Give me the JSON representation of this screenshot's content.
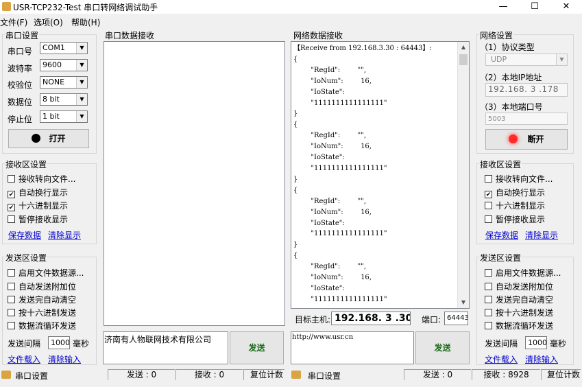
{
  "window": {
    "title": "USR-TCP232-Test 串口转网络调试助手",
    "minimize": "—",
    "maximize": "☐",
    "close": "✕"
  },
  "menu": {
    "file": "文件(F)",
    "options": "选项(O)",
    "help": "帮助(H)"
  },
  "serial_settings": {
    "title": "串口设置",
    "port_label": "串口号",
    "port_value": "COM1",
    "baud_label": "波特率",
    "baud_value": "9600",
    "parity_label": "校验位",
    "parity_value": "NONE",
    "data_label": "数据位",
    "data_value": "8 bit",
    "stop_label": "停止位",
    "stop_value": "1 bit",
    "open_button": "打开"
  },
  "serial_recv_settings": {
    "title": "接收区设置",
    "redirect": "接收转向文件...",
    "auto_newline": "自动换行显示",
    "hex_display": "十六进制显示",
    "pause": "暂停接收显示",
    "save": "保存数据",
    "clear": "清除显示",
    "checked": [
      false,
      true,
      true,
      false
    ]
  },
  "serial_send_settings": {
    "title": "发送区设置",
    "file_source": "启用文件数据源...",
    "auto_append": "自动发送附加位",
    "auto_clear": "发送完自动清空",
    "hex_send": "按十六进制发送",
    "loop_send": "数据流循环发送",
    "interval_label": "发送间隔",
    "interval_value": "1000",
    "interval_unit": "毫秒",
    "load_file": "文件载入",
    "clear_input": "清除输入"
  },
  "serial_recv": {
    "title": "串口数据接收"
  },
  "serial_send": {
    "text": "济南有人物联网技术有限公司",
    "send_button": "发送"
  },
  "net_recv": {
    "title": "网络数据接收",
    "content": "【Receive from 192.168.3.30 : 64443】:\n{\n        \"RegId\":        \"\",\n        \"IoNum\":        16,\n        \"IoState\":\n        \"1111111111111111\"\n}\n{\n        \"RegId\":        \"\",\n        \"IoNum\":        16,\n        \"IoState\":\n        \"1111111111111111\"\n}\n{\n        \"RegId\":        \"\",\n        \"IoNum\":        16,\n        \"IoState\":\n        \"1111111111111111\"\n}\n{\n        \"RegId\":        \"\",\n        \"IoNum\":        16,\n        \"IoState\":\n        \"1111111111111111\""
  },
  "net_target": {
    "host_label": "目标主机:",
    "host_value": "192.168. 3 .30",
    "port_label": "端口:",
    "port_value": "64443"
  },
  "net_send": {
    "text": "http://www.usr.cn",
    "send_button": "发送"
  },
  "net_settings": {
    "title": "网络设置",
    "protocol_label": "（1）协议类型",
    "protocol_value": "UDP",
    "ip_label": "（2）本地IP地址",
    "ip_value": "192.168. 3 .178",
    "port_label": "（3）本地端口号",
    "port_value": "5003",
    "disconnect_button": "断开"
  },
  "net_recv_settings": {
    "title": "接收区设置",
    "redirect": "接收转向文件...",
    "auto_newline": "自动换行显示",
    "hex_display": "十六进制显示",
    "pause": "暂停接收显示",
    "save": "保存数据",
    "clear": "清除显示",
    "checked": [
      false,
      true,
      false,
      false
    ]
  },
  "net_send_settings": {
    "title": "发送区设置",
    "file_source": "启用文件数据源...",
    "auto_append": "自动发送附加位",
    "auto_clear": "发送完自动清空",
    "hex_send": "按十六进制发送",
    "loop_send": "数据流循环发送",
    "interval_label": "发送间隔",
    "interval_value": "1000",
    "interval_unit": "毫秒",
    "load_file": "文件载入",
    "clear_input": "清除输入"
  },
  "status": {
    "left_label": "串口设置",
    "left_sent": "发送 : 0",
    "left_recv": "接收 : 0",
    "left_reset": "复位计数",
    "right_label": "串口设置",
    "right_sent": "发送 : 0",
    "right_recv": "接收 : 8928",
    "right_reset": "复位计数"
  },
  "icons": {
    "check": "✔",
    "arrow": "▼",
    "scroll_up": "▲",
    "scroll_down": "▼"
  },
  "colors": {
    "led_open": "#000000",
    "led_disconnect": "#ff2a2a",
    "link": "#0000cc"
  }
}
